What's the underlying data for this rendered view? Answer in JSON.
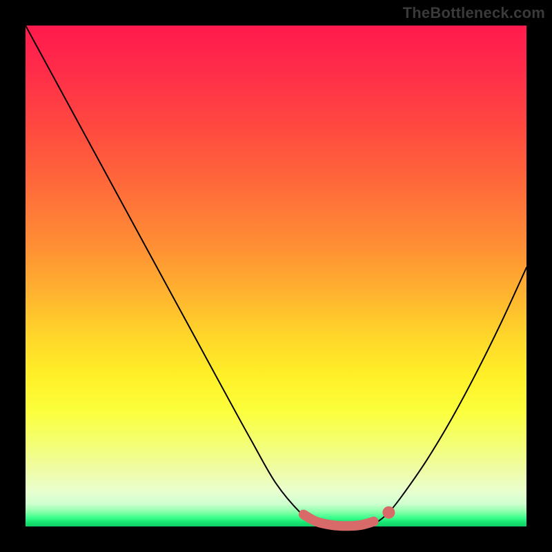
{
  "watermark": "TheBottleneck.com",
  "chart_data": {
    "type": "line",
    "title": "",
    "xlabel": "",
    "ylabel": "",
    "xlim": [
      0,
      1
    ],
    "ylim": [
      0,
      1
    ],
    "series": [
      {
        "name": "curve",
        "x": [
          0.0,
          0.05,
          0.1,
          0.15,
          0.2,
          0.25,
          0.3,
          0.35,
          0.4,
          0.45,
          0.5,
          0.55,
          0.575,
          0.6,
          0.625,
          0.65,
          0.675,
          0.7,
          0.725,
          0.75,
          0.8,
          0.85,
          0.9,
          0.95,
          1.0
        ],
        "y": [
          1.0,
          0.908,
          0.816,
          0.724,
          0.632,
          0.54,
          0.448,
          0.356,
          0.264,
          0.173,
          0.086,
          0.026,
          0.01,
          0.003,
          0.001,
          0.001,
          0.002,
          0.008,
          0.028,
          0.059,
          0.131,
          0.214,
          0.307,
          0.408,
          0.517
        ]
      },
      {
        "name": "trough-highlight",
        "x": [
          0.555,
          0.58,
          0.61,
          0.64,
          0.67,
          0.695
        ],
        "y": [
          0.024,
          0.01,
          0.003,
          0.001,
          0.003,
          0.01
        ]
      }
    ],
    "markers": [
      {
        "name": "trough-end-marker",
        "x": 0.725,
        "y": 0.028
      }
    ],
    "color_scale": {
      "direction": "vertical",
      "stops": [
        {
          "pos": 0.0,
          "color": "#ff1a4d"
        },
        {
          "pos": 0.5,
          "color": "#ffb52f"
        },
        {
          "pos": 0.8,
          "color": "#fbff3c"
        },
        {
          "pos": 1.0,
          "color": "#0fcf64"
        }
      ]
    }
  }
}
